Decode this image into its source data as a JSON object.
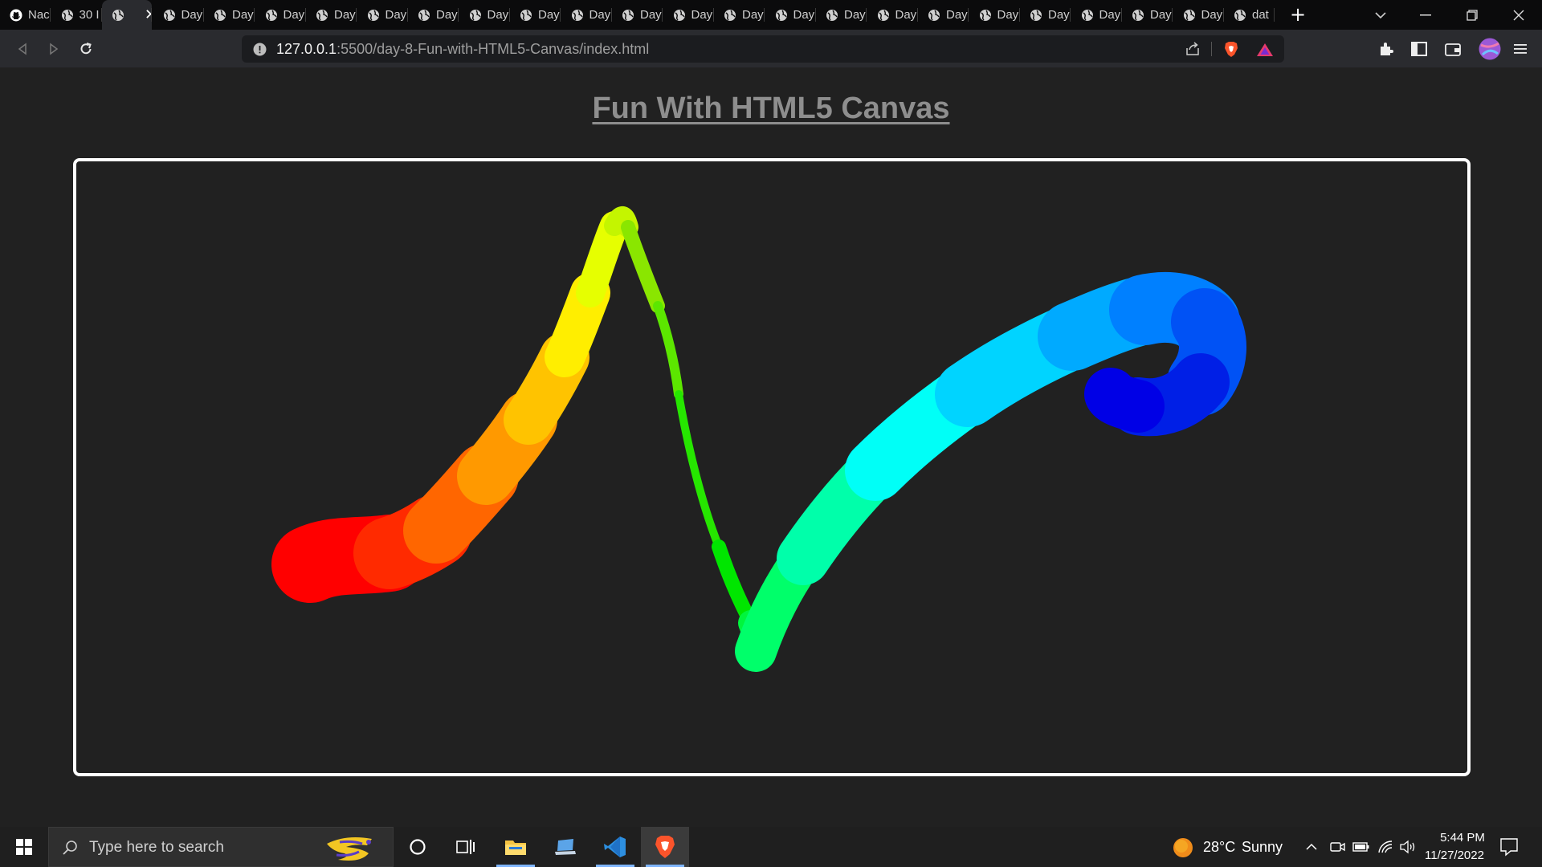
{
  "browser": {
    "tabs": [
      {
        "label": "Nac",
        "icon": "github-icon"
      },
      {
        "label": "30 I",
        "icon": "globe-icon"
      },
      {
        "label": "",
        "icon": "globe-icon",
        "active": true
      },
      {
        "label": "Day",
        "icon": "globe-icon"
      },
      {
        "label": "Day",
        "icon": "globe-icon"
      },
      {
        "label": "Day",
        "icon": "globe-icon"
      },
      {
        "label": "Day",
        "icon": "globe-icon"
      },
      {
        "label": "Day",
        "icon": "globe-icon"
      },
      {
        "label": "Day",
        "icon": "globe-icon"
      },
      {
        "label": "Day",
        "icon": "globe-icon"
      },
      {
        "label": "Day",
        "icon": "globe-icon"
      },
      {
        "label": "Day",
        "icon": "globe-icon"
      },
      {
        "label": "Day",
        "icon": "globe-icon"
      },
      {
        "label": "Day",
        "icon": "globe-icon"
      },
      {
        "label": "Day",
        "icon": "globe-icon"
      },
      {
        "label": "Day",
        "icon": "globe-icon"
      },
      {
        "label": "Day",
        "icon": "globe-icon"
      },
      {
        "label": "Day",
        "icon": "globe-icon"
      },
      {
        "label": "Day",
        "icon": "globe-icon"
      },
      {
        "label": "Day",
        "icon": "globe-icon"
      },
      {
        "label": "Day",
        "icon": "globe-icon"
      },
      {
        "label": "Day",
        "icon": "globe-icon"
      },
      {
        "label": "Day",
        "icon": "globe-icon"
      },
      {
        "label": "Day",
        "icon": "globe-icon"
      },
      {
        "label": "dat",
        "icon": "globe-icon"
      }
    ],
    "address": {
      "host": "127.0.0.1",
      "path": ":5500/day-8-Fun-with-HTML5-Canvas/index.html"
    }
  },
  "page": {
    "title": "Fun With HTML5 Canvas"
  },
  "taskbar": {
    "search_placeholder": "Type here to search",
    "weather_temp": "28°C",
    "weather_desc": "Sunny",
    "time": "5:44 PM",
    "date": "11/27/2022"
  },
  "colors": {
    "page_bg": "#212121",
    "canvas_border": "#ffffff",
    "title": "#8e8e8e"
  }
}
